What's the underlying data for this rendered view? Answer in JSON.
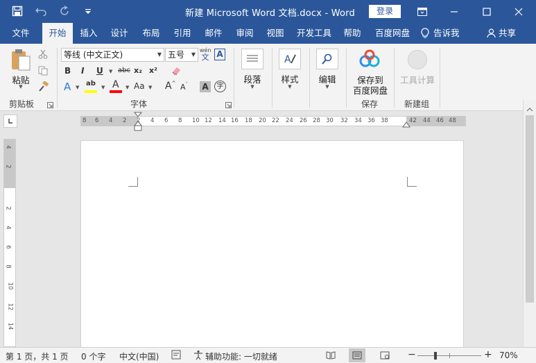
{
  "window": {
    "title": "新建 Microsoft Word 文档.docx  -  Word",
    "login_label": "登录"
  },
  "qat": {
    "save_icon": "save-icon",
    "undo_icon": "undo-icon",
    "redo_icon": "redo-icon",
    "customize_icon": "customize-qat-icon"
  },
  "tabs": [
    {
      "label": "文件"
    },
    {
      "label": "开始"
    },
    {
      "label": "插入"
    },
    {
      "label": "设计"
    },
    {
      "label": "布局"
    },
    {
      "label": "引用"
    },
    {
      "label": "邮件"
    },
    {
      "label": "审阅"
    },
    {
      "label": "视图"
    },
    {
      "label": "开发工具"
    },
    {
      "label": "帮助"
    },
    {
      "label": "百度网盘"
    },
    {
      "label": "告诉我"
    },
    {
      "label": "共享"
    }
  ],
  "ribbon": {
    "clipboard": {
      "paste_label": "粘贴",
      "group_label": "剪贴板"
    },
    "font": {
      "font_name": "等线 (中文正文)",
      "font_size": "五号",
      "phonetic_top": "wén",
      "phonetic_bottom": "文",
      "border_char": "A",
      "bold": "B",
      "italic": "I",
      "underline": "U",
      "strike": "abc",
      "subscript": "x₂",
      "superscript": "x²",
      "text_effect": "A",
      "highlight": "ab",
      "font_color": "A",
      "change_case": "Aa",
      "grow": "A",
      "shrink": "A",
      "char_shading": "A",
      "enclose": "字",
      "group_label": "字体"
    },
    "paragraph": {
      "label": "段落"
    },
    "styles": {
      "label": "样式"
    },
    "editing": {
      "label": "编辑"
    },
    "save_baidu": {
      "line1": "保存到",
      "line2": "百度网盘",
      "group_label": "保存"
    },
    "new_group": {
      "label": "工具计算",
      "group_label": "新建组"
    }
  },
  "ruler": {
    "h_ticks": [
      "8",
      "6",
      "4",
      "2",
      "2",
      "4",
      "6",
      "8",
      "10",
      "12",
      "14",
      "16",
      "18",
      "20",
      "22",
      "24",
      "26",
      "28",
      "30",
      "32",
      "34",
      "36",
      "38",
      "42",
      "44",
      "46",
      "48"
    ],
    "v_ticks": [
      "4",
      "2",
      "2",
      "4",
      "6",
      "8",
      "10",
      "12",
      "14"
    ]
  },
  "status": {
    "page": "第 1 页，共 1 页",
    "words": "0 个字",
    "language": "中文(中国)",
    "accessibility": "辅助功能: 一切就绪",
    "zoom": "70%",
    "zoom_minus": "−",
    "zoom_plus": "+"
  },
  "colors": {
    "brand": "#2b579a",
    "highlight": "#ffff00",
    "font_color": "#ff0000"
  }
}
